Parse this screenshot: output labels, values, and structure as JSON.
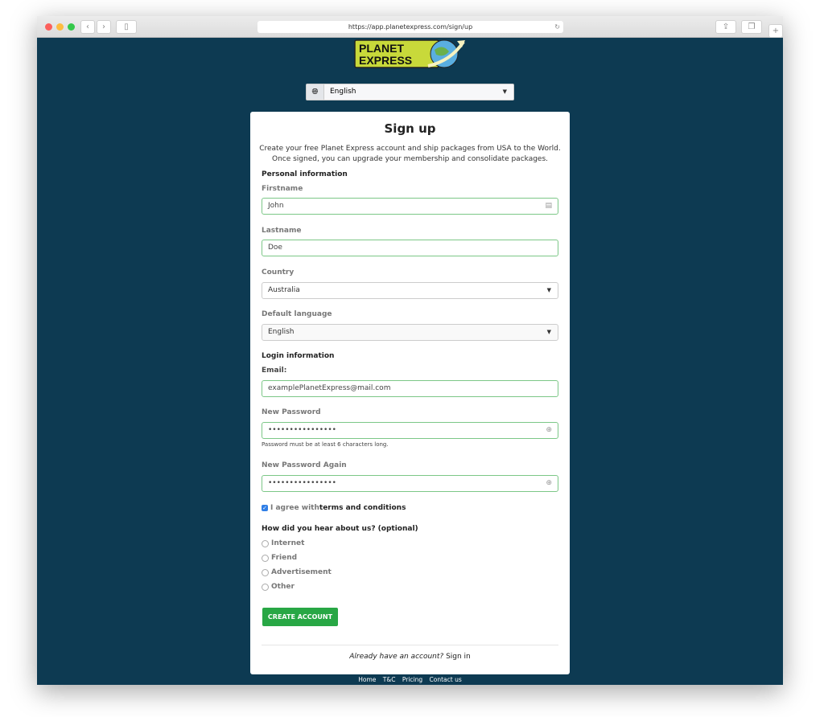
{
  "browser": {
    "url": "https://app.planetexpress.com/sign/up"
  },
  "logo": {
    "line1": "PLANET",
    "line2": "EXPRESS"
  },
  "language_selector": {
    "value": "English",
    "icon": "globe-icon"
  },
  "form": {
    "title": "Sign up",
    "intro": "Create your free Planet Express account and ship packages from USA to the World. Once signed, you can upgrade your membership and consolidate packages.",
    "personal_heading": "Personal information",
    "firstname": {
      "label": "Firstname",
      "value": "John"
    },
    "lastname": {
      "label": "Lastname",
      "value": "Doe"
    },
    "country": {
      "label": "Country",
      "value": "Australia"
    },
    "default_language": {
      "label": "Default language",
      "value": "English"
    },
    "login_heading": "Login information",
    "email": {
      "label": "Email:",
      "value": "examplePlanetExpress@mail.com"
    },
    "password": {
      "label": "New Password",
      "value": "••••••••••••••••",
      "hint": "Password must be at least 6 characters long."
    },
    "password_again": {
      "label": "New Password Again",
      "value": "••••••••••••••••"
    },
    "agree": {
      "prefix": "I agree with ",
      "link": "terms and conditions",
      "checked": true
    },
    "hear_heading": "How did you hear about us? (optional)",
    "hear_options": [
      "Internet",
      "Friend",
      "Advertisement",
      "Other"
    ],
    "submit": "CREATE ACCOUNT",
    "signin_prompt": "Already have an account?",
    "signin_link": "Sign in"
  },
  "footer": [
    "Home",
    "T&C",
    "Pricing",
    "Contact us"
  ],
  "colors": {
    "background": "#0d3a52",
    "accent": "#28a745",
    "valid_border": "#7cc787"
  }
}
